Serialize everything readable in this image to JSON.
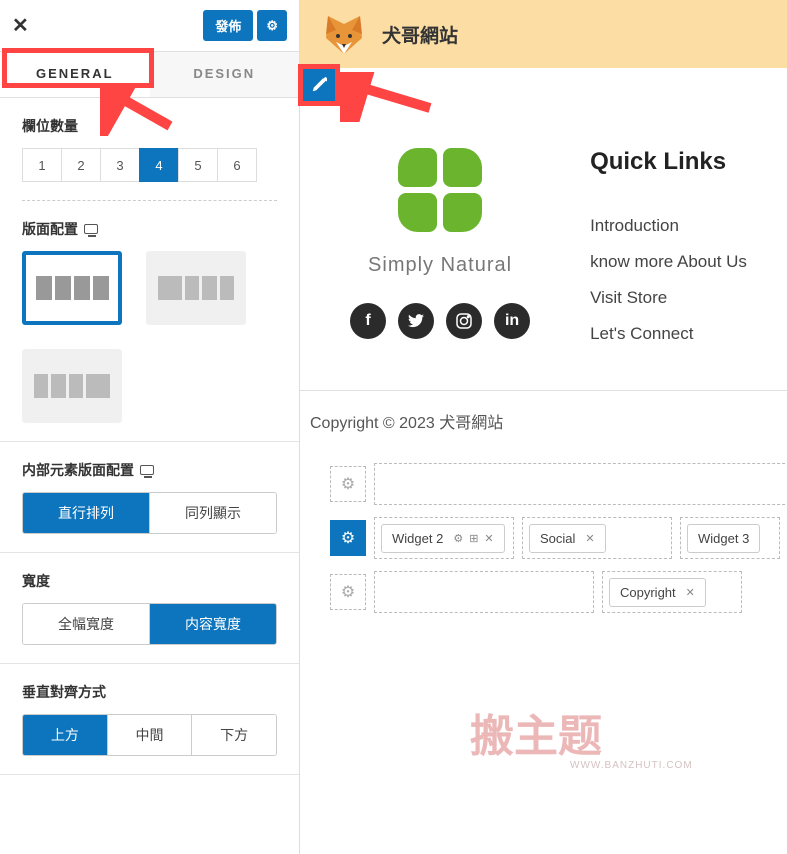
{
  "sidebar": {
    "publish_label": "發佈",
    "tabs": {
      "general": "GENERAL",
      "design": "DESIGN"
    },
    "col_count": {
      "title": "欄位數量",
      "options": [
        "1",
        "2",
        "3",
        "4",
        "5",
        "6"
      ],
      "active": "4"
    },
    "layout": {
      "title": "版面配置"
    },
    "inner_layout": {
      "title": "内部元素版面配置",
      "vertical": "直行排列",
      "horizontal": "同列顯示"
    },
    "width": {
      "title": "寬度",
      "full": "全幅寬度",
      "content": "内容寬度"
    },
    "valign": {
      "title": "垂直對齊方式",
      "top": "上方",
      "middle": "中間",
      "bottom": "下方"
    }
  },
  "preview": {
    "site_title": "犬哥網站",
    "brand_text": "Simply Natural",
    "quick_links": {
      "title": "Quick Links",
      "items": [
        "Introduction",
        "know more About Us",
        "Visit Store",
        "Let's Connect"
      ]
    },
    "copyright": "Copyright © 2023 犬哥網站",
    "builder": {
      "widget2": "Widget 2",
      "social": "Social",
      "widget3": "Widget 3",
      "copyright_chip": "Copyright"
    }
  },
  "watermark": {
    "text": "搬主题",
    "url": "WWW.BANZHUTI.COM"
  }
}
